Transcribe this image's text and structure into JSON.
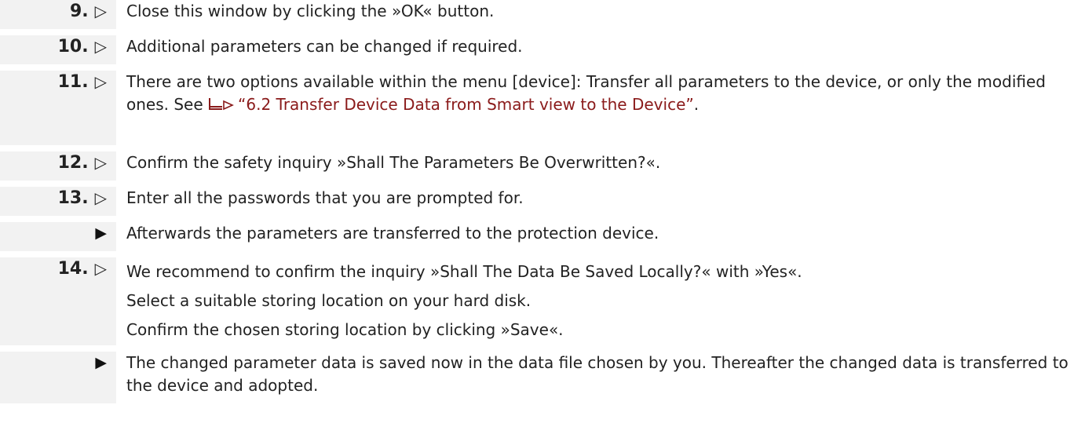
{
  "steps": [
    {
      "number": "9.",
      "symbol": "▷",
      "text": "Close this window by clicking the »OK« button."
    },
    {
      "number": "10.",
      "symbol": "▷",
      "text": "Additional parameters can be changed if required."
    },
    {
      "number": "11.",
      "symbol": "▷",
      "text_before": "There are two options available within the menu [device]: Transfer all parameters to the device, or only the modified ones. See ",
      "xref_icon": "cross-reference-arrow-icon",
      "link_text": "“6.2 Transfer Device Data from Smart view to the Device”",
      "text_after": "."
    },
    {
      "number": "12.",
      "symbol": "▷",
      "text": "Confirm the safety inquiry »Shall The Parameters Be Overwritten?«."
    },
    {
      "number": "13.",
      "symbol": "▷",
      "text": "Enter all the passwords that you are prompted for."
    },
    {
      "result_symbol": "▶",
      "text": "Afterwards the parameters are transferred to the protection device."
    },
    {
      "number": "14.",
      "symbol": "▷",
      "lines": [
        "We recommend to confirm the inquiry »Shall The Data Be Saved Locally?« with »Yes«.",
        "Select a suitable storing location on your hard disk.",
        "Confirm the chosen storing location by clicking »Save«."
      ]
    },
    {
      "result_symbol": "▶",
      "text": "The changed parameter data is saved now in the data file chosen by you. Thereafter the changed data is transferred to the device and adopted."
    }
  ]
}
